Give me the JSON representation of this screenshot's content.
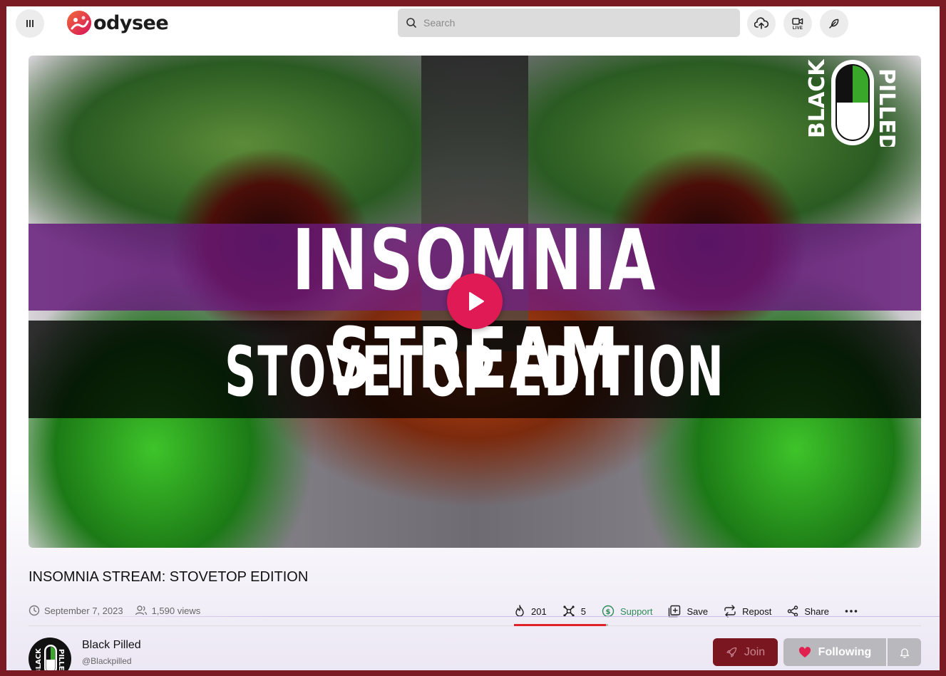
{
  "header": {
    "logo_text": "odysee",
    "search_placeholder": "Search",
    "live_label": "LIVE"
  },
  "video": {
    "thumbnail_line1": "INSOMNIA STREAM",
    "thumbnail_line2": "STOVETOP EDITION",
    "brand_mark_text_left": "BLACK",
    "brand_mark_text_right": "PILLED"
  },
  "details": {
    "title": "INSOMNIA STREAM: STOVETOP EDITION",
    "date": "September 7, 2023",
    "views": "1,590 views"
  },
  "actions": {
    "fire_count": "201",
    "slime_count": "5",
    "support_label": "Support",
    "save_label": "Save",
    "repost_label": "Repost",
    "share_label": "Share",
    "reaction_ratio": 0.976
  },
  "channel": {
    "name": "Black Pilled",
    "handle": "@Blackpilled",
    "avatar_text_left": "BLACK",
    "avatar_text_right": "PILLED"
  },
  "buttons": {
    "join_label": "Join",
    "following_label": "Following"
  },
  "colors": {
    "accent": "#e01a55",
    "support": "#2e8b57",
    "join_bg": "#7a1620"
  }
}
